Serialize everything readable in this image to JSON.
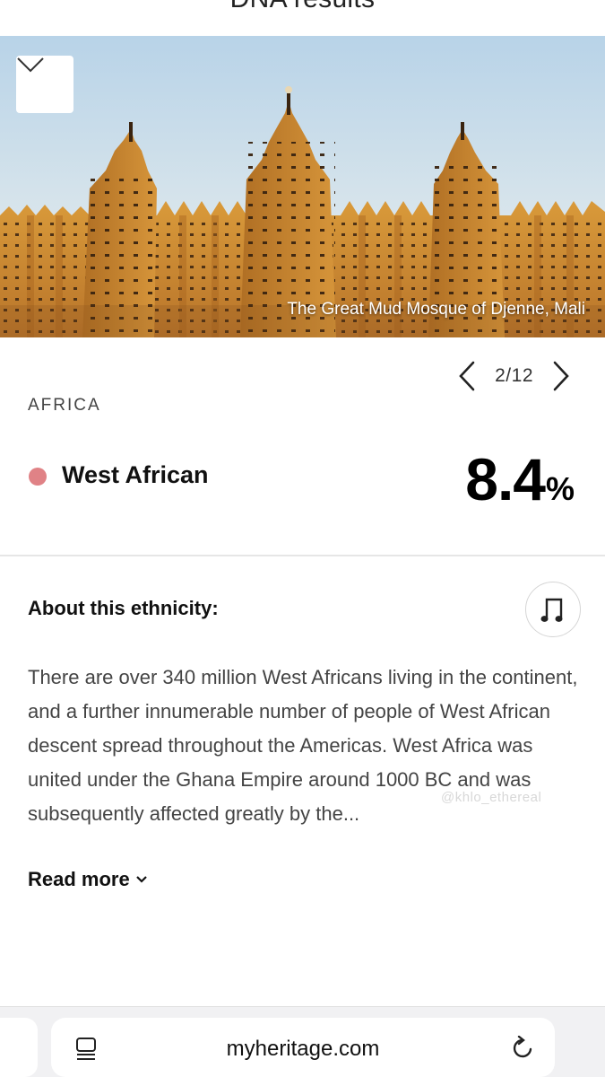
{
  "header": {
    "title": "DNA results"
  },
  "hero": {
    "caption": "The Great Mud Mosque of Djenne, Mali"
  },
  "pager": {
    "count": "2/12"
  },
  "region": {
    "label": "AFRICA"
  },
  "ethnicity": {
    "name": "West African",
    "percent_value": "8.4",
    "percent_sign": "%",
    "dot_color": "#e08286"
  },
  "about": {
    "title": "About this ethnicity:",
    "body": "There are over 340 million West Africans living in the continent, and a further innumerable number of people of West African descent spread throughout the Americas. West Africa was united under the Ghana Empire around 1000 BC and was subsequently affected greatly by the...",
    "read_more": "Read more"
  },
  "watermark": "@khlo_ethereal",
  "browser": {
    "url": "myheritage.com"
  }
}
